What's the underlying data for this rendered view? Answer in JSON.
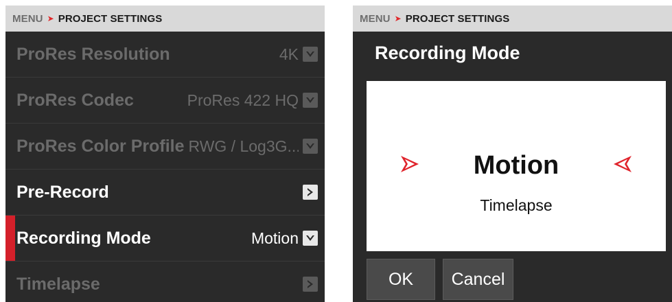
{
  "breadcrumb": {
    "menu": "MENU",
    "separator": ">",
    "current": "PROJECT SETTINGS"
  },
  "settings_list": [
    {
      "label": "ProRes Resolution",
      "value": "4K",
      "control": "dropdown",
      "state": "disabled"
    },
    {
      "label": "ProRes Codec",
      "value": "ProRes 422 HQ",
      "control": "dropdown",
      "state": "disabled"
    },
    {
      "label": "ProRes Color Profile",
      "value": "RWG / Log3G...",
      "control": "dropdown",
      "state": "disabled"
    },
    {
      "label": "Pre-Record",
      "value": "",
      "control": "submenu",
      "state": "enabled"
    },
    {
      "label": "Recording Mode",
      "value": "Motion",
      "control": "dropdown",
      "state": "selected"
    },
    {
      "label": "Timelapse",
      "value": "",
      "control": "submenu",
      "state": "disabled"
    }
  ],
  "dialog": {
    "title": "Recording Mode",
    "current_option": "Motion",
    "next_option": "Timelapse",
    "ok_label": "OK",
    "cancel_label": "Cancel"
  },
  "colors": {
    "panel_bg": "#2a2a2a",
    "accent_red": "#d4202a",
    "breadcrumb_bg": "#d9d9d9",
    "disabled_text": "#6b6b6b"
  },
  "icons": {
    "dropdown": "chevron-down-icon",
    "submenu": "chevron-right-icon",
    "option_prev": "arrow-left-icon",
    "option_next": "arrow-right-icon"
  }
}
